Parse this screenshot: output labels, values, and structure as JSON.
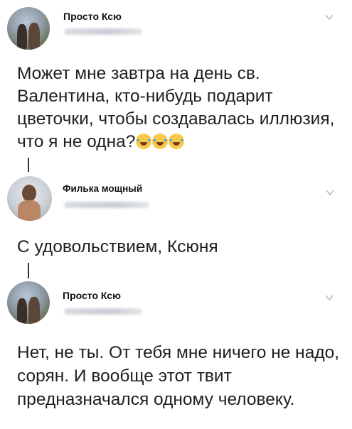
{
  "tweets": [
    {
      "author": "Просто Ксю",
      "text": "Может мне завтра на день св. Валентина, кто-нибудь подарит цветочки, чтобы создавалась иллюзия, что я не одна?",
      "emoji_icons": [
        "tears-of-joy-emoji",
        "tears-of-joy-emoji",
        "tears-of-joy-emoji"
      ]
    },
    {
      "author": "Филька мощный",
      "text": "С удовольствием, Ксюня"
    },
    {
      "author": "Просто Ксю",
      "text": "Нет, не ты. От тебя мне ничего не надо, сорян. И вообще этот твит предназначался одному человеку."
    }
  ],
  "icons": {
    "menu": "chevron-down-icon"
  },
  "colors": {
    "background": "#ffffff",
    "text": "#1f1f1f",
    "thread_line": "#333333",
    "chevron": "#b8bec5"
  }
}
